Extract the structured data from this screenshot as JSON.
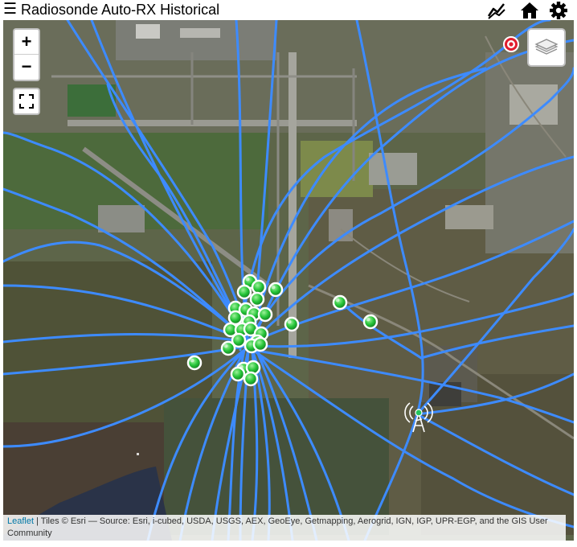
{
  "header": {
    "menu_icon": "hamburger-menu-icon",
    "title": "Radiosonde Auto-RX Historical",
    "icons": [
      "chart-line-icon",
      "home-icon",
      "gear-icon"
    ]
  },
  "map": {
    "controls": {
      "zoom_in": "+",
      "zoom_out": "−",
      "fullscreen_icon": "fullscreen-icon",
      "layers_icon": "layers-icon"
    },
    "attribution": {
      "link": "Leaflet",
      "text": " | Tiles © Esri — Source: Esri, i-cubed, USDA, USGS, AEX, GeoEye, Getmapping, Aerogrid, IGN, IGP, UPR-EGP, and the GIS User Community"
    },
    "colors": {
      "track": "#3d8bff",
      "marker_green": "#22c55e",
      "target_red": "#e11d2e"
    }
  }
}
